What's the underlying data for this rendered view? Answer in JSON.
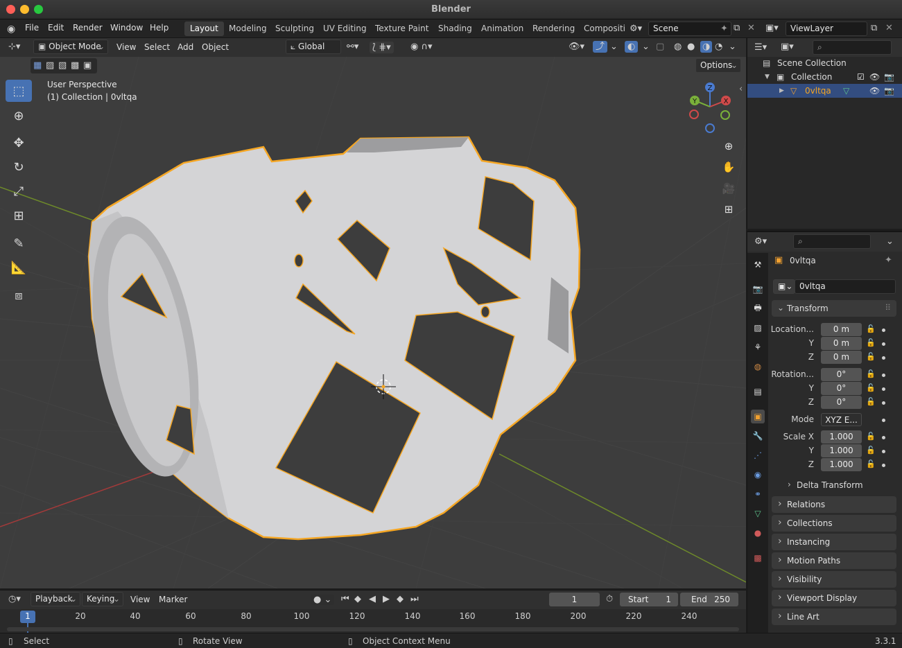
{
  "window": {
    "title": "Blender"
  },
  "menu": [
    "File",
    "Edit",
    "Render",
    "Window",
    "Help"
  ],
  "workspaces": [
    "Layout",
    "Modeling",
    "Sculpting",
    "UV Editing",
    "Texture Paint",
    "Shading",
    "Animation",
    "Rendering",
    "Compositi"
  ],
  "active_workspace": "Layout",
  "scene": {
    "name": "Scene"
  },
  "viewlayer": {
    "name": "ViewLayer"
  },
  "viewport_header": {
    "mode": "Object Mode",
    "menus": [
      "View",
      "Select",
      "Add",
      "Object"
    ],
    "orientation": "Global",
    "options": "Options"
  },
  "viewport_overlay": {
    "perspective": "User Perspective",
    "collection": "(1) Collection | 0vltqa"
  },
  "gizmo": {
    "x": "X",
    "y": "Y",
    "z": "Z"
  },
  "outliner": {
    "scene_collection": "Scene Collection",
    "collection": "Collection",
    "object": "0vltqa"
  },
  "properties": {
    "object_name": "0vltqa",
    "data_name": "0vltqa",
    "transform_title": "Transform",
    "location_label": "Location...",
    "rotation_label": "Rotation...",
    "scale_label": "Scale X",
    "y_label": "Y",
    "z_label": "Z",
    "location": [
      "0 m",
      "0 m",
      "0 m"
    ],
    "rotation": [
      "0°",
      "0°",
      "0°"
    ],
    "mode_label": "Mode",
    "mode_value": "XYZ E...",
    "scale": [
      "1.000",
      "1.000",
      "1.000"
    ],
    "delta_transform": "Delta Transform",
    "panels": [
      "Relations",
      "Collections",
      "Instancing",
      "Motion Paths",
      "Visibility",
      "Viewport Display",
      "Line Art"
    ]
  },
  "timeline": {
    "menus": [
      "Playback",
      "Keying",
      "View",
      "Marker"
    ],
    "current_frame": "1",
    "start_label": "Start",
    "start": "1",
    "end_label": "End",
    "end": "250",
    "ruler": [
      "1",
      "20",
      "40",
      "60",
      "80",
      "100",
      "120",
      "140",
      "160",
      "180",
      "200",
      "220",
      "240"
    ]
  },
  "statusbar": {
    "select": "Select",
    "rotate": "Rotate View",
    "context": "Object Context Menu",
    "version": "3.3.1"
  },
  "colors": {
    "accent": "#4772b3",
    "selection_outline": "#f5a623",
    "viewport_bg": "#3d3d3d"
  }
}
